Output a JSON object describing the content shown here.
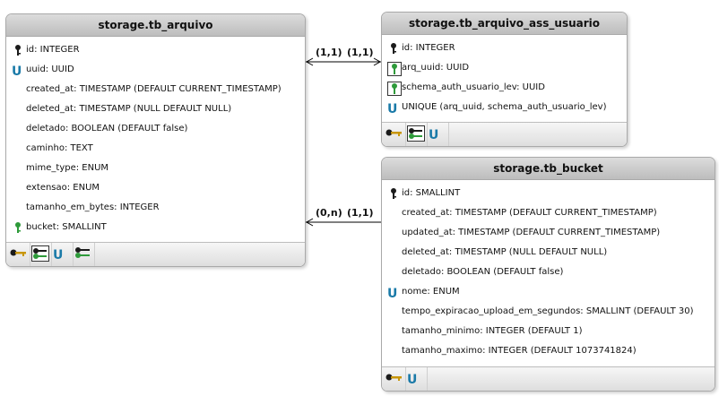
{
  "tables": [
    {
      "title": "storage.tb_arquivo",
      "columns": [
        {
          "icon": "key",
          "text": "id: INTEGER"
        },
        {
          "icon": "unique",
          "text": "uuid: UUID"
        },
        {
          "icon": "",
          "text": "created_at: TIMESTAMP (DEFAULT CURRENT_TIMESTAMP)"
        },
        {
          "icon": "",
          "text": "deleted_at: TIMESTAMP (NULL DEFAULT NULL)"
        },
        {
          "icon": "",
          "text": "deletado: BOOLEAN (DEFAULT false)"
        },
        {
          "icon": "",
          "text": "caminho: TEXT"
        },
        {
          "icon": "",
          "text": "mime_type: ENUM"
        },
        {
          "icon": "",
          "text": "extensao: ENUM"
        },
        {
          "icon": "",
          "text": "tamanho_em_bytes: INTEGER"
        },
        {
          "icon": "fk",
          "text": "bucket: SMALLINT"
        }
      ],
      "footer_icons": [
        "primary-key-icon",
        "selected-key-icon",
        "unique-icon",
        "foreign-key-icon"
      ]
    },
    {
      "title": "storage.tb_arquivo_ass_usuario",
      "columns": [
        {
          "icon": "key",
          "text": "id: INTEGER"
        },
        {
          "icon": "fk-box",
          "text": "arq_uuid: UUID"
        },
        {
          "icon": "fk-box",
          "text": "schema_auth_usuario_lev: UUID"
        },
        {
          "icon": "unique",
          "text": "UNIQUE (arq_uuid, schema_auth_usuario_lev)"
        }
      ],
      "footer_icons": [
        "primary-key-icon",
        "selected-key-icon",
        "unique-icon"
      ]
    },
    {
      "title": "storage.tb_bucket",
      "columns": [
        {
          "icon": "key",
          "text": "id: SMALLINT"
        },
        {
          "icon": "",
          "text": "created_at: TIMESTAMP (DEFAULT CURRENT_TIMESTAMP)"
        },
        {
          "icon": "",
          "text": "updated_at: TIMESTAMP (DEFAULT CURRENT_TIMESTAMP)"
        },
        {
          "icon": "",
          "text": "deleted_at: TIMESTAMP (NULL DEFAULT NULL)"
        },
        {
          "icon": "",
          "text": "deletado: BOOLEAN (DEFAULT false)"
        },
        {
          "icon": "unique",
          "text": "nome: ENUM"
        },
        {
          "icon": "",
          "text": "tempo_expiracao_upload_em_segundos: SMALLINT (DEFAULT 30)"
        },
        {
          "icon": "",
          "text": "tamanho_minimo: INTEGER (DEFAULT 1)"
        },
        {
          "icon": "",
          "text": "tamanho_maximo: INTEGER (DEFAULT 1073741824)"
        }
      ],
      "footer_icons": [
        "primary-key-icon",
        "unique-icon"
      ]
    }
  ],
  "relationships": [
    {
      "from_label": "(1,1)",
      "to_label": "(1,1)"
    },
    {
      "from_label": "(0,n)",
      "to_label": "(1,1)"
    }
  ],
  "colors": {
    "header_top": "#dcdcdc",
    "header_bottom": "#bdbdbd",
    "key": "#1b1b1b",
    "fk_green": "#2e9a3a",
    "unique_blue": "#1a7aa8",
    "pk_gold": "#c8960a"
  }
}
